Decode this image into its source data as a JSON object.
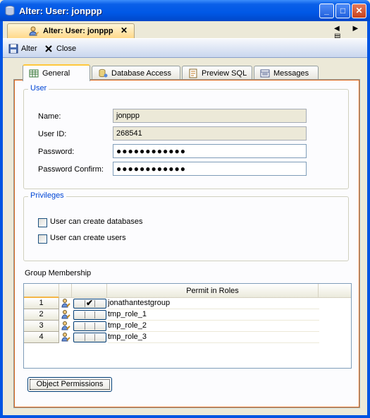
{
  "window": {
    "title": "Alter: User: jonppp",
    "minimize": "_",
    "maximize": "□",
    "close": "✕"
  },
  "doc_tab": {
    "label": "Alter: User: jonppp",
    "close": "✕",
    "nav": "◀ ▶ ▤"
  },
  "toolbar": {
    "alter_label": "Alter",
    "close_label": "Close"
  },
  "tabs": [
    {
      "label": "General",
      "icon": "table-icon",
      "active": true
    },
    {
      "label": "Database Access",
      "icon": "database-access-icon"
    },
    {
      "label": "Preview SQL",
      "icon": "sql-icon"
    },
    {
      "label": "Messages",
      "icon": "messages-icon"
    }
  ],
  "user_group": {
    "legend": "User",
    "name_label": "Name:",
    "name_value": "jonppp",
    "userid_label": "User ID:",
    "userid_value": "268541",
    "password_label": "Password:",
    "password_value": "●●●●●●●●●●●●",
    "confirm_label": "Password Confirm:",
    "confirm_value": "●●●●●●●●●●●●"
  },
  "privileges": {
    "legend": "Privileges",
    "create_db_label": "User can create databases",
    "create_users_label": "User can create users"
  },
  "group_membership": {
    "label": "Group Membership",
    "column_header": "Permit in Roles",
    "rows": [
      {
        "num": "1",
        "checked": true,
        "name": "jonathantestgroup"
      },
      {
        "num": "2",
        "checked": false,
        "name": "tmp_role_1"
      },
      {
        "num": "3",
        "checked": false,
        "name": "tmp_role_2"
      },
      {
        "num": "4",
        "checked": false,
        "name": "tmp_role_3"
      }
    ]
  },
  "object_permissions_label": "Object Permissions",
  "colors": {
    "title_blue": "#0058e6",
    "accent_orange": "#e06a1c",
    "legend_blue": "#0046d5"
  }
}
